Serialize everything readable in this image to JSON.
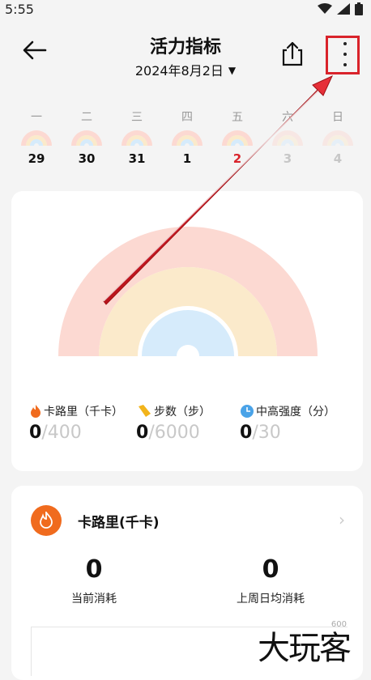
{
  "status_bar": {
    "time": "5:55"
  },
  "header": {
    "title": "活力指标",
    "date": "2024年8月2日",
    "date_caret": "▼"
  },
  "week": {
    "days": [
      {
        "weekday": "一",
        "date": "29",
        "faded": false,
        "highlight": false
      },
      {
        "weekday": "二",
        "date": "30",
        "faded": false,
        "highlight": false
      },
      {
        "weekday": "三",
        "date": "31",
        "faded": false,
        "highlight": false
      },
      {
        "weekday": "四",
        "date": "1",
        "faded": false,
        "highlight": false
      },
      {
        "weekday": "五",
        "date": "2",
        "faded": false,
        "highlight": true
      },
      {
        "weekday": "六",
        "date": "3",
        "faded": true,
        "highlight": false
      },
      {
        "weekday": "日",
        "date": "4",
        "faded": true,
        "highlight": false
      }
    ]
  },
  "summary": {
    "metrics": [
      {
        "label": "卡路里（千卡）",
        "value": "0",
        "goal": "/400",
        "icon": "flame-icon",
        "color": "#f06b1e"
      },
      {
        "label": "步数（步）",
        "value": "0",
        "goal": "/6000",
        "icon": "footprint-icon",
        "color": "#f2b41b"
      },
      {
        "label": "中高强度（分）",
        "value": "0",
        "goal": "/30",
        "icon": "clock-icon",
        "color": "#4aa3e8"
      }
    ],
    "rings": {
      "calorie_color": "#fcd9d2",
      "steps_color": "#fbeacb",
      "intensity_color": "#d6ebfb"
    }
  },
  "calorie_card": {
    "title": "卡路里(千卡)",
    "current_value": "0",
    "current_label": "当前消耗",
    "lastweek_value": "0",
    "lastweek_label": "上周日均消耗",
    "axis_max": "600"
  },
  "watermark": "大玩客",
  "accent": "#d9232b"
}
